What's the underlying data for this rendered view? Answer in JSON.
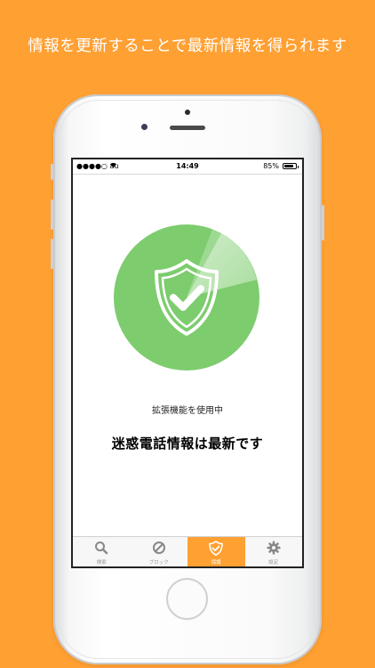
{
  "headline": "情報を更新することで最新情報を得られます",
  "status_bar": {
    "carrier": "●●●●○ au",
    "time": "14:49",
    "battery": "85%",
    "battery_level": 0.85
  },
  "main": {
    "extension_status": "拡張機能を使用中",
    "database_status": "迷惑電話情報は最新です",
    "shield_icon": "shield-check-icon",
    "accent_color": "#7DCC6E"
  },
  "tabs": [
    {
      "label": "検索",
      "icon": "search-icon",
      "active": false
    },
    {
      "label": "ブロック",
      "icon": "block-icon",
      "active": false
    },
    {
      "label": "保護",
      "icon": "shield-check-icon",
      "active": true
    },
    {
      "label": "設定",
      "icon": "gear-icon",
      "active": false
    }
  ],
  "colors": {
    "background": "#FFA033",
    "tab_active": "#FFA033",
    "green": "#7DCC6E"
  }
}
